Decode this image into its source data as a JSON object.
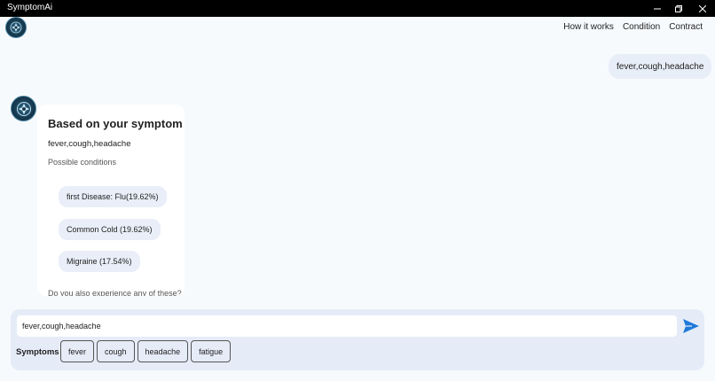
{
  "window": {
    "title": "SymptomAi",
    "controls": [
      "minimize",
      "restore",
      "close"
    ]
  },
  "nav": {
    "items": [
      "How it works",
      "Condition",
      "Contract"
    ]
  },
  "chat": {
    "user_message": "fever,cough,headache",
    "bot_card": {
      "title": "Based on your symptom",
      "symptom_text": "fever,cough,headache",
      "subtitle": "Possible conditions",
      "conditions": [
        "first Disease: Flu(19.62%)",
        "Common Cold (19.62%)",
        "Migraine (17.54%)"
      ],
      "followup_question": "Do you also experience any of these?"
    }
  },
  "composer": {
    "input_value": "fever,cough,headache",
    "send_icon": "send-icon",
    "symptoms_label": "Symptoms :",
    "symptom_chips": [
      "fever",
      "cough",
      "headache",
      "fatigue"
    ]
  },
  "colors": {
    "accent": "#1f7ad8",
    "bubble": "#e8eef8",
    "panel": "#e5ecf8"
  }
}
